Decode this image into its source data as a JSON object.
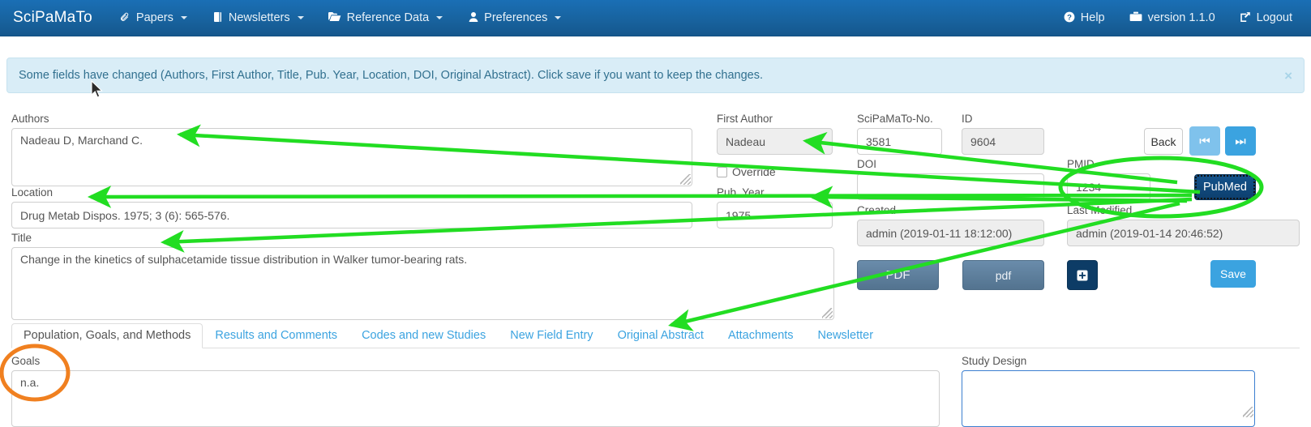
{
  "navbar": {
    "brand": "SciPaMaTo",
    "items": [
      {
        "label": "Papers",
        "icon": "paperclip-icon",
        "caret": true
      },
      {
        "label": "Newsletters",
        "icon": "book-icon",
        "caret": true
      },
      {
        "label": "Reference Data",
        "icon": "folder-icon",
        "caret": true
      },
      {
        "label": "Preferences",
        "icon": "user-icon",
        "caret": true
      }
    ],
    "right_items": [
      {
        "label": "Help",
        "icon": "question-circle-icon"
      },
      {
        "label": "version 1.1.0",
        "icon": "suitcase-icon"
      },
      {
        "label": "Logout",
        "icon": "sign-out-icon"
      }
    ]
  },
  "alert": {
    "message": "Some fields have changed (Authors, First Author, Title, Pub. Year, Location, DOI, Original Abstract). Click save if you want to keep the changes.",
    "close_label": "×"
  },
  "form": {
    "authors": {
      "label": "Authors",
      "value": "Nadeau D, Marchand C."
    },
    "location": {
      "label": "Location",
      "value": "Drug Metab Dispos. 1975; 3 (6): 565-576."
    },
    "title": {
      "label": "Title",
      "value": "Change in the kinetics of sulphacetamide tissue distribution in Walker tumor-bearing rats."
    },
    "first_author": {
      "label": "First Author",
      "value": "Nadeau"
    },
    "override": {
      "label": "Override",
      "checked": false
    },
    "pub_year": {
      "label": "Pub. Year",
      "value": "1975"
    },
    "scipamato_no": {
      "label": "SciPaMaTo-No.",
      "value": "3581"
    },
    "id": {
      "label": "ID",
      "value": "9604"
    },
    "doi": {
      "label": "DOI",
      "value": ""
    },
    "pmid": {
      "label": "PMID",
      "value": "1234"
    },
    "created": {
      "label": "Created",
      "value": "admin (2019-01-11 18:12:00)"
    },
    "last_modified": {
      "label": "Last Modified",
      "value": "admin (2019-01-14 20:46:52)"
    }
  },
  "buttons": {
    "back": "Back",
    "first": "⏮",
    "last": "⏭",
    "pubmed": "PubMed",
    "pdf_upper": "PDF",
    "pdf_lower": "pdf",
    "add": "＋",
    "save": "Save"
  },
  "tabs": [
    {
      "label": "Population, Goals, and Methods",
      "active": true
    },
    {
      "label": "Results and Comments",
      "active": false
    },
    {
      "label": "Codes and new Studies",
      "active": false
    },
    {
      "label": "New Field Entry",
      "active": false
    },
    {
      "label": "Original Abstract",
      "active": false
    },
    {
      "label": "Attachments",
      "active": false
    },
    {
      "label": "Newsletter",
      "active": false
    }
  ],
  "tab_panel": {
    "goals": {
      "label": "Goals",
      "value": "n.a."
    },
    "study_design": {
      "label": "Study Design",
      "value": ""
    }
  },
  "annotations": {
    "arrow_color": "#22dd22",
    "ellipse_green_color": "#22dd22",
    "ellipse_orange_color": "#f08020"
  },
  "colors": {
    "navbar": "#18639f",
    "alert_bg": "#d9edf7",
    "alert_text": "#31708f",
    "link": "#3ba3e0",
    "primary": "#3ba3e0",
    "navy": "#0d3c66",
    "slate": "#5c7d99"
  }
}
